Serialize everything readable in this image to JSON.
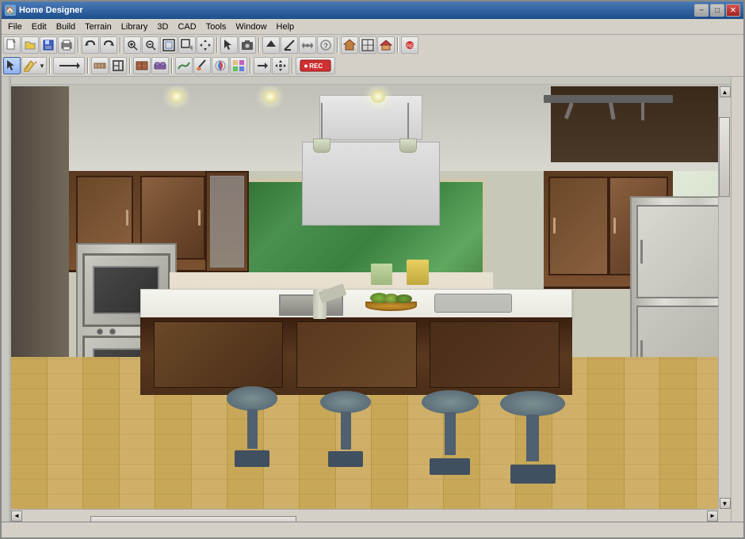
{
  "window": {
    "title": "Home Designer",
    "title_icon": "🏠"
  },
  "controls": {
    "minimize": "−",
    "maximize": "□",
    "close": "✕"
  },
  "menu": {
    "items": [
      "File",
      "Edit",
      "Build",
      "Terrain",
      "Library",
      "3D",
      "CAD",
      "Tools",
      "Window",
      "Help"
    ]
  },
  "toolbar1": {
    "buttons": [
      {
        "name": "new",
        "icon": "📄"
      },
      {
        "name": "open",
        "icon": "📂"
      },
      {
        "name": "save",
        "icon": "💾"
      },
      {
        "name": "print",
        "icon": "🖨"
      },
      {
        "name": "undo",
        "icon": "↩"
      },
      {
        "name": "redo",
        "icon": "↪"
      },
      {
        "name": "zoom-in",
        "icon": "🔍+"
      },
      {
        "name": "zoom-out",
        "icon": "🔍-"
      },
      {
        "name": "zoom-fit",
        "icon": "⊞"
      },
      {
        "name": "zoom-window",
        "icon": "⊡"
      },
      {
        "name": "pan",
        "icon": "✋"
      },
      {
        "name": "select",
        "icon": "↖"
      },
      {
        "name": "draw-wall",
        "icon": "▭"
      },
      {
        "name": "door",
        "icon": "🚪"
      },
      {
        "name": "window",
        "icon": "⊟"
      },
      {
        "name": "stairs",
        "icon": "≡"
      },
      {
        "name": "camera",
        "icon": "📷"
      },
      {
        "name": "render",
        "icon": "◈"
      },
      {
        "name": "up-arrow",
        "icon": "↑"
      },
      {
        "name": "angle",
        "icon": "∠"
      },
      {
        "name": "measure",
        "icon": "📏"
      },
      {
        "name": "help",
        "icon": "?"
      },
      {
        "name": "house",
        "icon": "🏠"
      },
      {
        "name": "floor",
        "icon": "⊠"
      },
      {
        "name": "roof",
        "icon": "△"
      },
      {
        "name": "record",
        "icon": "⏺"
      }
    ]
  },
  "toolbar2": {
    "buttons": [
      {
        "name": "select2",
        "icon": "↖"
      },
      {
        "name": "pencil",
        "icon": "✏"
      },
      {
        "name": "line-drop",
        "icon": "⌐"
      },
      {
        "name": "wall-style",
        "icon": "▬"
      },
      {
        "name": "room",
        "icon": "▪"
      },
      {
        "name": "object",
        "icon": "◫"
      },
      {
        "name": "cabinet",
        "icon": "▣"
      },
      {
        "name": "furniture",
        "icon": "🪑"
      },
      {
        "name": "terrain2",
        "icon": "~"
      },
      {
        "name": "brush",
        "icon": "🖌"
      },
      {
        "name": "paint",
        "icon": "🎨"
      },
      {
        "name": "color",
        "icon": "◉"
      },
      {
        "name": "material",
        "icon": "◈"
      },
      {
        "name": "arrow-right",
        "icon": "→"
      },
      {
        "name": "move",
        "icon": "✥"
      },
      {
        "name": "rec-btn",
        "icon": "⏺"
      }
    ]
  },
  "statusbar": {
    "text": ""
  }
}
